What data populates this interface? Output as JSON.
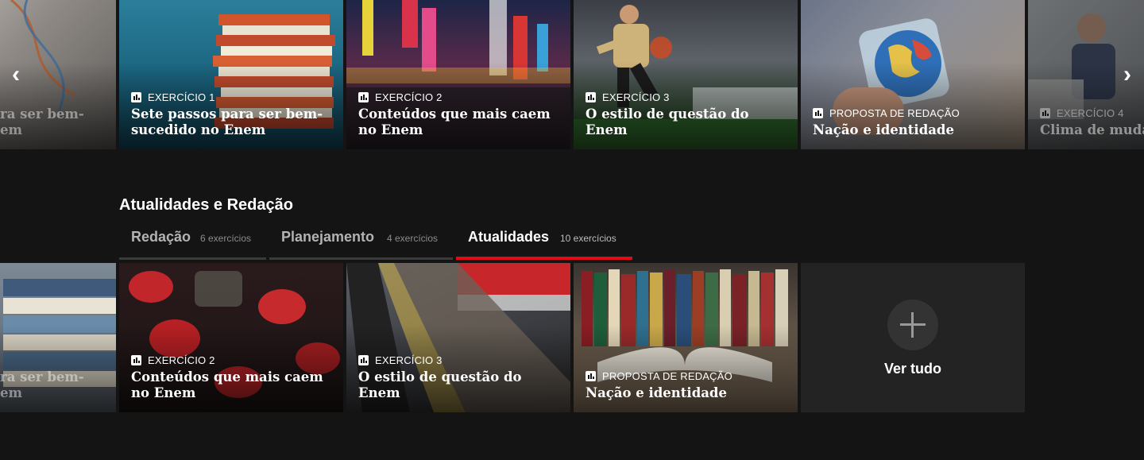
{
  "nav": {
    "prev": "‹",
    "next": "›"
  },
  "row1": {
    "cards": [
      {
        "tag": "",
        "title": "ra ser bem-\nem"
      },
      {
        "tag": "EXERCÍCIO 1",
        "title": "Sete passos para ser bem-\nsucedido no Enem"
      },
      {
        "tag": "EXERCÍCIO 2",
        "title": "Conteúdos que mais caem\nno Enem"
      },
      {
        "tag": "EXERCÍCIO 3",
        "title": "O estilo de questão do\nEnem"
      },
      {
        "tag": "PROPOSTA DE REDAÇÃO",
        "title": "Nação e identidade"
      },
      {
        "tag": "EXERCÍCIO 4",
        "title": "Clima de muda"
      }
    ]
  },
  "section": {
    "title": "Atualidades e Redação",
    "tabs": [
      {
        "label": "Redação",
        "count": "6 exercícios"
      },
      {
        "label": "Planejamento",
        "count": "4 exercícios"
      },
      {
        "label": "Atualidades",
        "count": "10 exercícios"
      }
    ]
  },
  "row2": {
    "cards": [
      {
        "tag": "",
        "title": "ra ser bem-\nem"
      },
      {
        "tag": "EXERCÍCIO 2",
        "title": "Conteúdos que mais caem\nno Enem"
      },
      {
        "tag": "EXERCÍCIO 3",
        "title": "O estilo de questão do\nEnem"
      },
      {
        "tag": "PROPOSTA DE REDAÇÃO",
        "title": "Nação e identidade"
      }
    ],
    "see_all": "Ver tudo"
  },
  "colors": {
    "accent": "#e50914",
    "background": "#141414"
  }
}
